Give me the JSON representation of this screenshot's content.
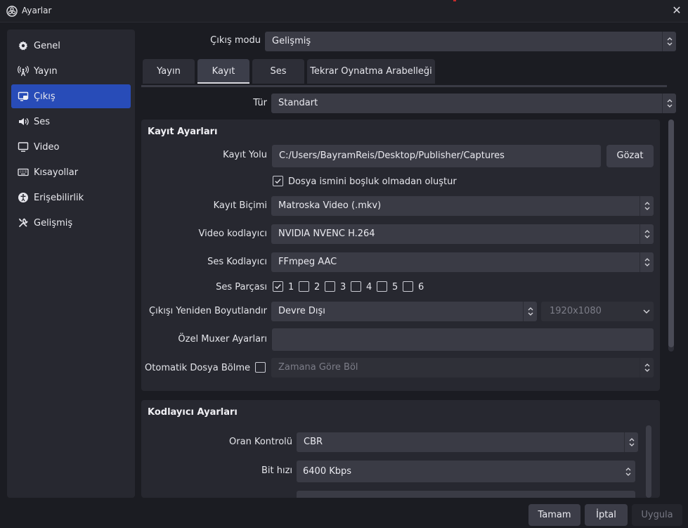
{
  "window": {
    "title": "Ayarlar"
  },
  "sidebar": {
    "items": [
      {
        "label": "Genel",
        "icon": "gear-icon"
      },
      {
        "label": "Yayın",
        "icon": "broadcast-icon"
      },
      {
        "label": "Çıkış",
        "icon": "output-icon",
        "active": true
      },
      {
        "label": "Ses",
        "icon": "speaker-icon"
      },
      {
        "label": "Video",
        "icon": "monitor-icon"
      },
      {
        "label": "Kısayollar",
        "icon": "keyboard-icon"
      },
      {
        "label": "Erişebilirlik",
        "icon": "accessibility-icon"
      },
      {
        "label": "Gelişmiş",
        "icon": "tools-icon"
      }
    ]
  },
  "output_mode": {
    "label": "Çıkış modu",
    "value": "Gelişmiş"
  },
  "tabs": [
    {
      "label": "Yayın"
    },
    {
      "label": "Kayıt",
      "active": true
    },
    {
      "label": "Ses"
    },
    {
      "label": "Tekrar Oynatma Arabelleği"
    }
  ],
  "type": {
    "label": "Tür",
    "value": "Standart"
  },
  "recording": {
    "title": "Kayıt Ayarları",
    "path_label": "Kayıt Yolu",
    "path_value": "C:/Users/BayramReis/Desktop/Publisher/Captures",
    "browse_label": "Gözat",
    "no_space_label": "Dosya ismini boşluk olmadan oluştur",
    "no_space_checked": true,
    "format_label": "Kayıt Biçimi",
    "format_value": "Matroska Video (.mkv)",
    "video_encoder_label": "Video kodlayıcı",
    "video_encoder_value": "NVIDIA NVENC H.264",
    "audio_encoder_label": "Ses Kodlayıcı",
    "audio_encoder_value": "FFmpeg AAC",
    "tracks_label": "Ses Parçası",
    "tracks": [
      {
        "label": "1",
        "checked": true
      },
      {
        "label": "2",
        "checked": false
      },
      {
        "label": "3",
        "checked": false
      },
      {
        "label": "4",
        "checked": false
      },
      {
        "label": "5",
        "checked": false
      },
      {
        "label": "6",
        "checked": false
      }
    ],
    "rescale_label": "Çıkışı Yeniden Boyutlandır",
    "rescale_value": "Devre Dışı",
    "rescale_resolution": "1920x1080",
    "muxer_label": "Özel Muxer Ayarları",
    "muxer_value": "",
    "split_label": "Otomatik Dosya Bölme",
    "split_value": "Zamana Göre Böl"
  },
  "encoder": {
    "title": "Kodlayıcı Ayarları",
    "rate_control_label": "Oran Kontrolü",
    "rate_control_value": "CBR",
    "bitrate_label": "Bit hızı",
    "bitrate_value": "6400 Kbps"
  },
  "footer": {
    "ok_label": "Tamam",
    "cancel_label": "İptal",
    "apply_label": "Uygula"
  },
  "colors": {
    "accent": "#284cb8",
    "panel": "#272830",
    "input": "#3a3b45"
  }
}
